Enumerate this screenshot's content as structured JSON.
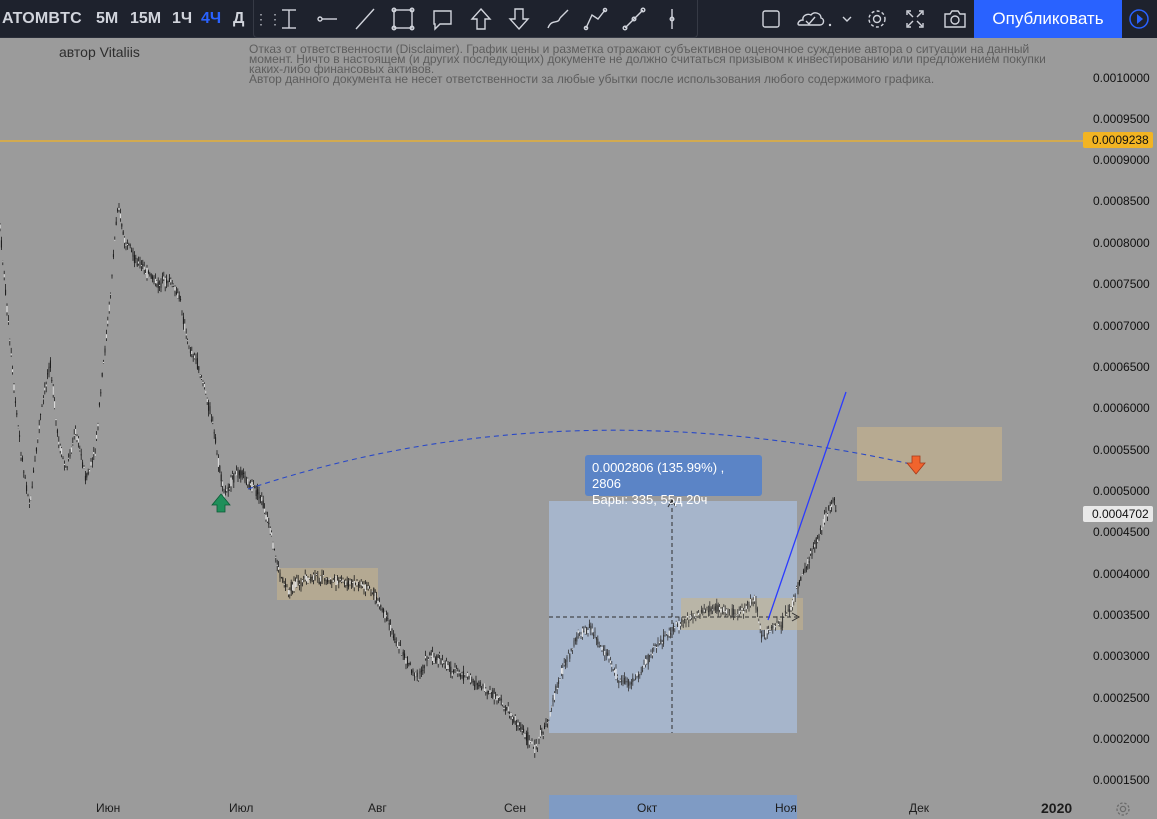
{
  "header": {
    "symbol": "ATOMBTC",
    "timeframes": [
      "5М",
      "15М",
      "1Ч",
      "4Ч",
      "Д"
    ],
    "active_timeframe": "4Ч",
    "drawing_tools": [
      "cross-line-icon",
      "horizontal-ray-icon",
      "trend-line-icon",
      "rectangle-icon",
      "callout-icon",
      "arrow-up-icon",
      "arrow-down-icon",
      "brush-icon",
      "path-icon",
      "arrow-line-icon",
      "vertical-line-icon"
    ],
    "publish_label": "Опубликовать"
  },
  "chart": {
    "author": "автор Vitaliis",
    "disclaimer_lines": [
      "Отказ от ответственности (Disclaimer). График цены и разметка отражают субъективное оценочное суждение автора о ситуации на данный",
      "момент. Ничто в настоящем (и других последующих) документе не должно считаться призывом к инвестированию или предложением покупки",
      "каких-либо финансовых активов.",
      "Автор данного документа не несет ответственности за любые убытки после использования любого содержимого графика."
    ],
    "price_scale": [
      "0.0010000",
      "0.0009500",
      "0.0009000",
      "0.0008500",
      "0.0008000",
      "0.0007500",
      "0.0007000",
      "0.0006500",
      "0.0006000",
      "0.0005500",
      "0.0005000",
      "0.0004500",
      "0.0004000",
      "0.0003500",
      "0.0003000",
      "0.0002500",
      "0.0002000",
      "0.0001500"
    ],
    "horizontal_line_price": "0.0009238",
    "last_price": "0.0004702",
    "time_scale": [
      "Июн",
      "Июл",
      "Авг",
      "Сен",
      "Окт",
      "Ноя",
      "Дек",
      "2020"
    ],
    "measurement": {
      "line1": "0.0002806 (135.99%) , 2806",
      "line2": "Бары: 335, 55д 20ч"
    },
    "colors": {
      "background": "#9b9b9b",
      "candles": "#1a1a1a",
      "horizontal_line": "#f2b423",
      "measure_fill": "#a8bad3",
      "measure_label": "#5b84c6",
      "trend_line": "#2b3bff",
      "zone": "#c9b48a",
      "arrow_up": "#1f8f5a",
      "arrow_down": "#f0642d"
    }
  }
}
